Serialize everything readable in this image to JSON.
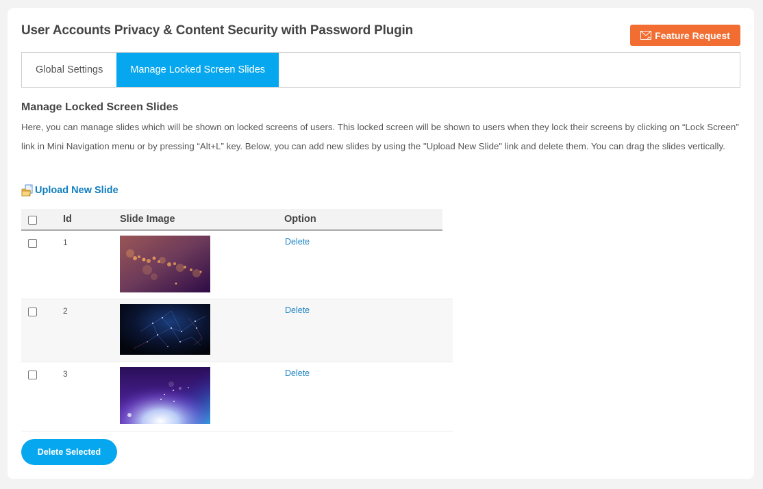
{
  "header": {
    "title": "User Accounts Privacy & Content Security with Password Plugin",
    "feature_request_label": "Feature Request",
    "feature_request_icon": "envelope-icon"
  },
  "tabs": [
    {
      "label": "Global Settings",
      "active": false
    },
    {
      "label": "Manage Locked Screen Slides",
      "active": true
    }
  ],
  "section": {
    "title": "Manage Locked Screen Slides",
    "description": "Here, you can manage slides which will be shown on locked screens of users. This locked screen will be shown to users when they lock their screens by clicking on “Lock Screen” link in Mini Navigation menu or by pressing “Alt+L” key. Below, you can add new slides by using the \"Upload New Slide\" link and delete them. You can drag the slides vertically."
  },
  "upload": {
    "label": "Upload New Slide",
    "icon": "folder-upload-icon"
  },
  "table": {
    "columns": [
      "Id",
      "Slide Image",
      "Option"
    ],
    "rows": [
      {
        "id": "1",
        "image": "bokeh-orange-purple",
        "option": "Delete"
      },
      {
        "id": "2",
        "image": "network-constellation-dark",
        "option": "Delete"
      },
      {
        "id": "3",
        "image": "purple-blue-light-burst",
        "option": "Delete"
      }
    ]
  },
  "actions": {
    "delete_selected_label": "Delete Selected"
  },
  "colors": {
    "accent": "#06a7ef",
    "feature_button": "#f26d32",
    "link": "#1a82c3"
  }
}
